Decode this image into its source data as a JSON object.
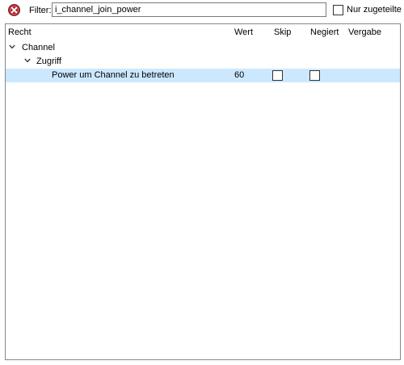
{
  "toolbar": {
    "clear_icon": "clear-filter-icon",
    "filter_label": "Filter:",
    "filter_value": "i_channel_join_power",
    "only_assigned_label": "Nur zugeteilte",
    "only_assigned_checked": false
  },
  "table": {
    "columns": [
      "Recht",
      "Wert",
      "Skip",
      "Negiert",
      "Vergabe"
    ],
    "groups": [
      {
        "label": "Channel",
        "expanded": true,
        "children": [
          {
            "label": "Zugriff",
            "expanded": true,
            "permissions": [
              {
                "name": "Power um Channel zu betreten",
                "wert": "60",
                "skip": false,
                "negiert": false,
                "vergabe": "",
                "selected": true
              }
            ]
          }
        ]
      }
    ]
  },
  "colors": {
    "selection": "#cce8ff",
    "border": "#828790",
    "clear_icon_fill": "#b4262f"
  }
}
